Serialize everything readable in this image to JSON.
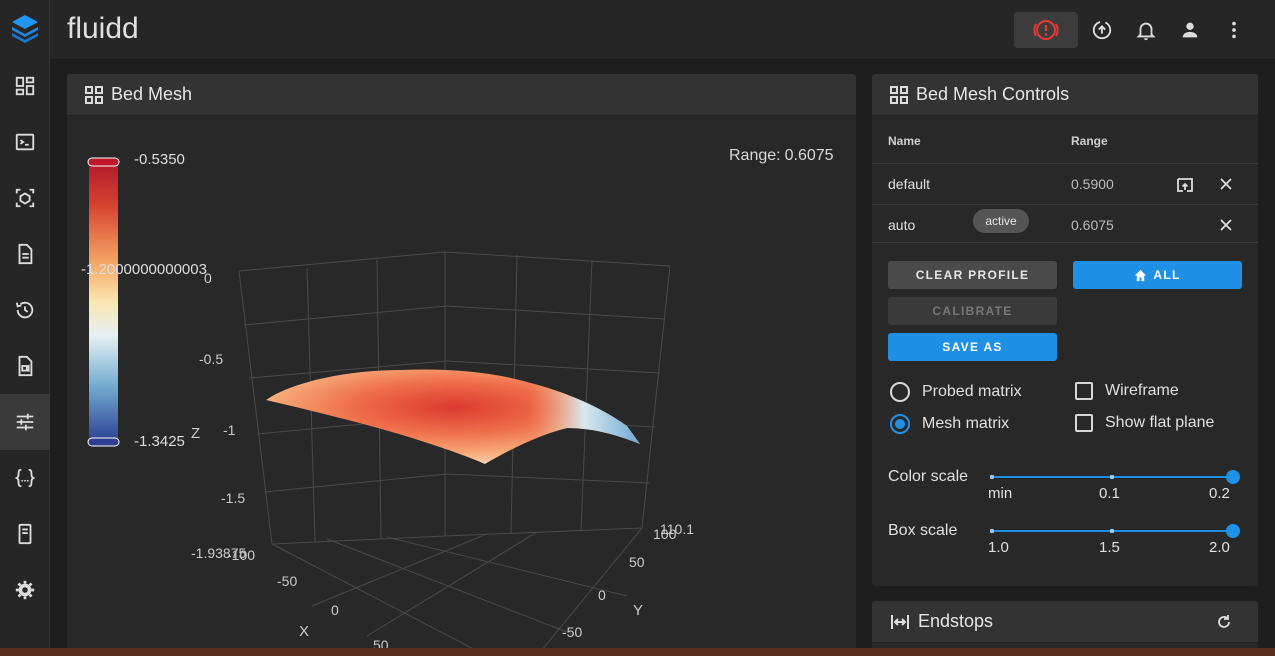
{
  "app": {
    "title": "fluidd"
  },
  "sidebar": {
    "items": [
      {
        "name": "dashboard",
        "icon": "dashboard-icon"
      },
      {
        "name": "console",
        "icon": "console-icon"
      },
      {
        "name": "jobs",
        "icon": "cube-scan-icon"
      },
      {
        "name": "files",
        "icon": "file-list-icon"
      },
      {
        "name": "history",
        "icon": "history-icon"
      },
      {
        "name": "timelapse",
        "icon": "video-file-icon"
      },
      {
        "name": "tune",
        "icon": "tune-icon",
        "active": true
      },
      {
        "name": "macros",
        "icon": "code-braces-icon"
      },
      {
        "name": "system",
        "icon": "system-icon"
      },
      {
        "name": "settings",
        "icon": "gear-icon"
      }
    ]
  },
  "bed_mesh": {
    "title": "Bed Mesh",
    "range_label": "Range:",
    "range_value": "0.6075",
    "colorbar": {
      "max": "-0.5350",
      "min": "-1.3425",
      "overlap_label": "-1.2000000000003"
    },
    "z_axis": {
      "title": "Z",
      "ticks": [
        "0",
        "-0.5",
        "-1",
        "-1.5",
        "-1.93875"
      ]
    },
    "x_axis": {
      "title": "X",
      "ticks": [
        "-100",
        "-50",
        "0",
        "50"
      ]
    },
    "y_axis": {
      "title": "Y",
      "ticks": [
        "110.1",
        "100",
        "50",
        "0",
        "-50"
      ]
    }
  },
  "controls": {
    "title": "Bed Mesh Controls",
    "columns": {
      "name": "Name",
      "range": "Range"
    },
    "profiles": [
      {
        "name": "default",
        "range": "0.5900",
        "active": false
      },
      {
        "name": "auto",
        "range": "0.6075",
        "active": true,
        "badge": "active"
      }
    ],
    "buttons": {
      "clear": "Clear Profile",
      "home": "All",
      "calibrate": "Calibrate",
      "save_as": "Save As"
    },
    "options": {
      "probed": "Probed matrix",
      "mesh": "Mesh matrix",
      "wireframe": "Wireframe",
      "flat_plane": "Show flat plane",
      "selected_matrix": "mesh"
    },
    "color_scale": {
      "label": "Color scale",
      "ticks": [
        "min",
        "0.1",
        "0.2"
      ]
    },
    "box_scale": {
      "label": "Box scale",
      "ticks": [
        "1.0",
        "1.5",
        "2.0"
      ]
    }
  },
  "endstops": {
    "title": "Endstops"
  },
  "colors": {
    "accent": "#1e90e6",
    "danger": "#e53935"
  }
}
